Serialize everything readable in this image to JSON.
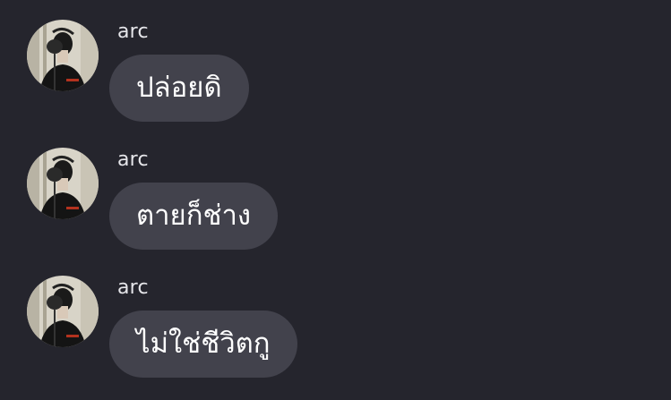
{
  "theme": {
    "background": "#25252d",
    "bubble": "#42424c",
    "text": "#ffffff",
    "sender_text": "#e6e6ea"
  },
  "messages": [
    {
      "sender": "arc",
      "avatar_icon": "user-avatar-photo",
      "text": "ปล่อยดิ"
    },
    {
      "sender": "arc",
      "avatar_icon": "user-avatar-photo",
      "text": "ตายก็ช่าง"
    },
    {
      "sender": "arc",
      "avatar_icon": "user-avatar-photo",
      "text": "ไม่ใช่ชีวิตกู"
    }
  ]
}
